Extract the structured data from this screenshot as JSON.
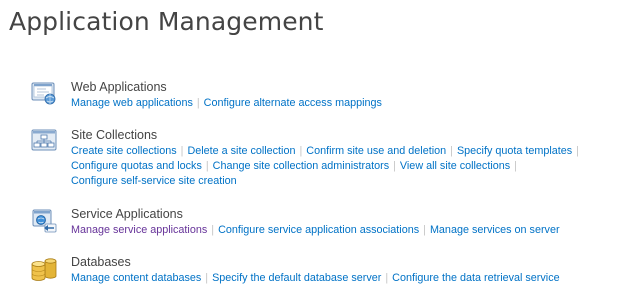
{
  "page": {
    "title": "Application Management"
  },
  "colors": {
    "link": "#0072c6",
    "visited_link": "#663399",
    "heading": "#444444",
    "separator": "#c6c6c6"
  },
  "sections": [
    {
      "icon": "web-applications-icon",
      "heading": "Web Applications",
      "links": [
        "Manage web applications",
        "Configure alternate access mappings"
      ]
    },
    {
      "icon": "site-collections-icon",
      "heading": "Site Collections",
      "links": [
        "Create site collections",
        "Delete a site collection",
        "Confirm site use and deletion",
        "Specify quota templates",
        "Configure quotas and locks",
        "Change site collection administrators",
        "View all site collections",
        "Configure self-service site creation"
      ]
    },
    {
      "icon": "service-applications-icon",
      "heading": "Service Applications",
      "links": [
        "Manage service applications",
        "Configure service application associations",
        "Manage services on server"
      ]
    },
    {
      "icon": "databases-icon",
      "heading": "Databases",
      "links": [
        "Manage content databases",
        "Specify the default database server",
        "Configure the data retrieval service"
      ]
    }
  ],
  "separator": "|"
}
